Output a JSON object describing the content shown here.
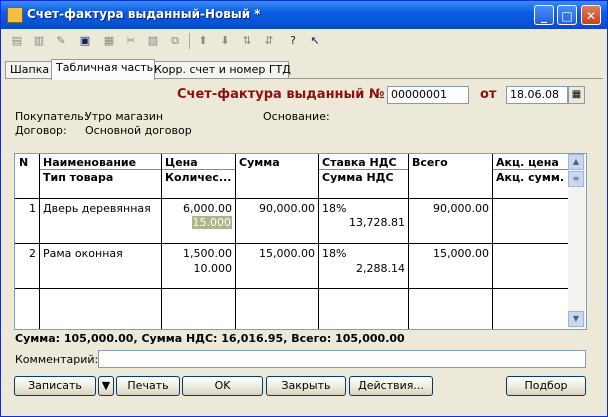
{
  "window": {
    "title": "Счет-фактура выданный-Новый *"
  },
  "toolbar": {
    "icons": [
      "add-row-icon",
      "copy-row-icon",
      "edit-row-icon",
      "save-icon",
      "delete-row-icon",
      "cut-icon",
      "end-edit-icon",
      "copy-icon",
      "move-up-icon",
      "move-down-icon",
      "sort-asc-icon",
      "sort-desc-icon",
      "help-icon",
      "context-help-icon"
    ]
  },
  "tabs": [
    {
      "label": "Шапка"
    },
    {
      "label": "Табличная часть"
    },
    {
      "label": "Корр. счет и номер ГТД"
    }
  ],
  "header": {
    "doc_title": "Счет-фактура выданный №",
    "number": "00000001",
    "from_label": "от",
    "date": "18.06.08",
    "buyer_label": "Покупатель:",
    "buyer": "Утро магазин",
    "basis_label": "Основание:",
    "contract_label": "Договор:",
    "contract": "Основной договор"
  },
  "table": {
    "headers": {
      "n": "N",
      "name": "Наименование",
      "type": "Тип товара",
      "price": "Цена",
      "qty": "Количес...",
      "sum": "Сумма",
      "vat_rate": "Ставка НДС",
      "vat_sum": "Сумма НДС",
      "total": "Всего",
      "excise_price": "Акц. цена",
      "excise_sum": "Акц. сумм."
    },
    "rows": [
      {
        "n": "1",
        "name": "Дверь деревянная",
        "price": "6,000.00",
        "qty": "15.000",
        "sum": "90,000.00",
        "vat_rate": "18%",
        "vat_sum": "13,728.81",
        "total": "90,000.00"
      },
      {
        "n": "2",
        "name": "Рама оконная",
        "price": "1,500.00",
        "qty": "10.000",
        "sum": "15,000.00",
        "vat_rate": "18%",
        "vat_sum": "2,288.14",
        "total": "15,000.00"
      }
    ]
  },
  "totals": "Сумма: 105,000.00, Сумма НДС: 16,016.95, Всего: 105,000.00",
  "comment": {
    "label": "Комментарий:",
    "value": ""
  },
  "buttons": {
    "save": "Записать",
    "print": "Печать",
    "ok": "OK",
    "close": "Закрыть",
    "actions": "Действия...",
    "selection": "Подбор"
  }
}
